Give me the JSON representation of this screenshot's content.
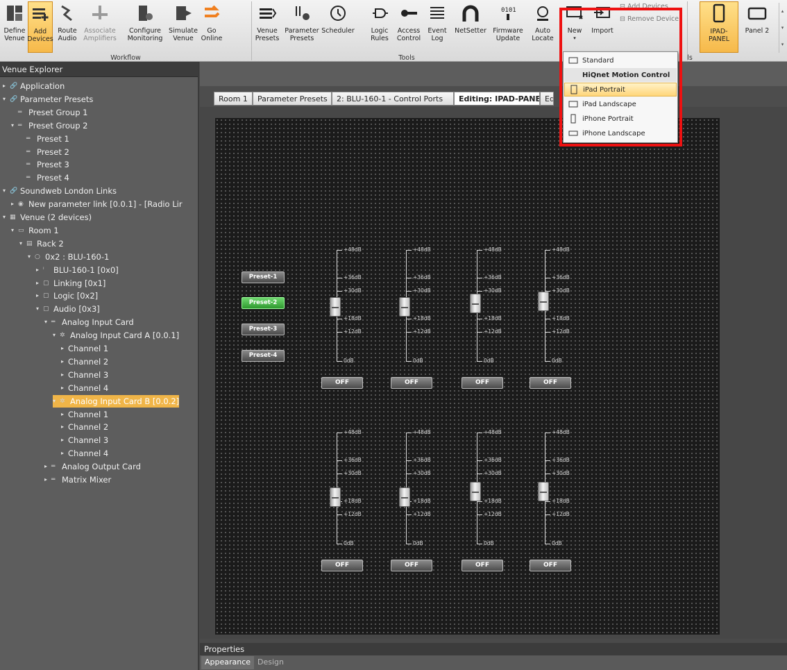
{
  "ribbon": {
    "groups": {
      "workflow": "Workflow",
      "tools": "Tools",
      "panels_partial": "ls"
    },
    "buttons": {
      "define_venue": "Define\nVenue",
      "add_devices": "Add\nDevices",
      "route_audio": "Route\nAudio",
      "associate_amplifiers": "Associate\nAmplifiers",
      "configure_monitoring": "Configure\nMonitoring",
      "simulate_venue": "Simulate\nVenue",
      "go_online": "Go\nOnline",
      "venue_presets": "Venue\nPresets",
      "parameter_presets": "Parameter\nPresets",
      "scheduler": "Scheduler",
      "logic_rules": "Logic\nRules",
      "access_control": "Access\nControl",
      "event_log": "Event\nLog",
      "netsetter": "NetSetter",
      "firmware_update": "Firmware\nUpdate",
      "auto_locate": "Auto\nLocate",
      "new": "New",
      "import": "Import",
      "add_devices_small": "Add Devices",
      "remove_device": "Remove Device",
      "ipad_panel": "IPAD-PANEL",
      "panel2": "Panel 2"
    }
  },
  "explorer": {
    "title": "Venue Explorer",
    "items": [
      {
        "label": "Application",
        "indent": 0,
        "arrow": "▸",
        "icon": "link-icon"
      },
      {
        "label": "Parameter Presets",
        "indent": 0,
        "arrow": "▾",
        "icon": "link-icon"
      },
      {
        "label": "Preset Group 1",
        "indent": 1,
        "arrow": "",
        "icon": "group-icon"
      },
      {
        "label": "Preset Group 2",
        "indent": 1,
        "arrow": "▾",
        "icon": "group-icon"
      },
      {
        "label": "Preset 1",
        "indent": 2,
        "arrow": "",
        "icon": "group-icon"
      },
      {
        "label": "Preset 2",
        "indent": 2,
        "arrow": "",
        "icon": "group-icon"
      },
      {
        "label": "Preset 3",
        "indent": 2,
        "arrow": "",
        "icon": "group-icon"
      },
      {
        "label": "Preset 4",
        "indent": 2,
        "arrow": "",
        "icon": "group-icon"
      },
      {
        "label": "Soundweb London Links",
        "indent": 0,
        "arrow": "▾",
        "icon": "link-icon"
      },
      {
        "label": "New parameter link  [0.0.1]  -  [Radio Lir",
        "indent": 1,
        "arrow": "▸",
        "icon": "param-link-icon"
      },
      {
        "label": "Venue (2 devices)",
        "indent": 0,
        "arrow": "▾",
        "icon": "venue-icon"
      },
      {
        "label": "Room 1",
        "indent": 1,
        "arrow": "▾",
        "icon": "room-icon"
      },
      {
        "label": "Rack 2",
        "indent": 2,
        "arrow": "▾",
        "icon": "rack-icon"
      },
      {
        "label": "0x2 : BLU-160-1",
        "indent": 3,
        "arrow": "▾",
        "icon": "node-icon"
      },
      {
        "label": "BLU-160-1 [0x0]",
        "indent": 4,
        "arrow": "▸",
        "icon": "info-icon"
      },
      {
        "label": "Linking [0x1]",
        "indent": 4,
        "arrow": "▸",
        "icon": "folder-icon"
      },
      {
        "label": "Logic [0x2]",
        "indent": 4,
        "arrow": "▸",
        "icon": "folder-icon"
      },
      {
        "label": "Audio [0x3]",
        "indent": 4,
        "arrow": "▾",
        "icon": "folder-icon"
      },
      {
        "label": "Analog Input Card",
        "indent": 5,
        "arrow": "▾",
        "icon": "card-icon"
      },
      {
        "label": "Analog Input Card A [0.0.1]",
        "indent": 6,
        "arrow": "▾",
        "icon": "gear-icon"
      },
      {
        "label": "Channel 1",
        "indent": 7,
        "arrow": "▸",
        "icon": ""
      },
      {
        "label": "Channel 2",
        "indent": 7,
        "arrow": "▸",
        "icon": ""
      },
      {
        "label": "Channel 3",
        "indent": 7,
        "arrow": "▸",
        "icon": ""
      },
      {
        "label": "Channel 4",
        "indent": 7,
        "arrow": "▸",
        "icon": ""
      },
      {
        "label": "Analog Input Card B [0.0.2]",
        "indent": 6,
        "arrow": "▾",
        "icon": "gear-icon",
        "selected": true
      },
      {
        "label": "Channel 1",
        "indent": 7,
        "arrow": "▸",
        "icon": ""
      },
      {
        "label": "Channel 2",
        "indent": 7,
        "arrow": "▸",
        "icon": ""
      },
      {
        "label": "Channel 3",
        "indent": 7,
        "arrow": "▸",
        "icon": ""
      },
      {
        "label": "Channel 4",
        "indent": 7,
        "arrow": "▸",
        "icon": ""
      },
      {
        "label": "Analog Output Card",
        "indent": 5,
        "arrow": "▸",
        "icon": "card-icon"
      },
      {
        "label": "Matrix Mixer",
        "indent": 5,
        "arrow": "▸",
        "icon": "card-icon"
      }
    ]
  },
  "tabs": [
    "Room 1",
    "Parameter Presets",
    "2: BLU-160-1 - Control Ports",
    "Editing: IPAD-PANEL",
    "Ed"
  ],
  "active_tab": 3,
  "panel": {
    "presets": [
      "Preset-1",
      "Preset-2",
      "Preset-3",
      "Preset-4"
    ],
    "active_preset": 1,
    "fader_scale": [
      "+48dB",
      "+36dB",
      "+30dB",
      "+18dB",
      "+12dB",
      "0dB"
    ],
    "fader_rows": [
      {
        "levels": [
          0.47,
          0.47,
          0.5,
          0.52
        ]
      },
      {
        "levels": [
          0.4,
          0.4,
          0.45,
          0.45
        ]
      }
    ],
    "off_label": "OFF"
  },
  "dropdown": {
    "items": [
      {
        "label": "Standard",
        "icon": "standard-icon"
      },
      {
        "label": "HiQnet Motion Control",
        "header": true
      },
      {
        "label": "iPad Portrait",
        "icon": "ipad-portrait-icon",
        "hover": true
      },
      {
        "label": "iPad Landscape",
        "icon": "ipad-landscape-icon"
      },
      {
        "label": "iPhone Portrait",
        "icon": "iphone-portrait-icon"
      },
      {
        "label": "iPhone Landscape",
        "icon": "iphone-landscape-icon"
      }
    ]
  },
  "properties": {
    "title": "Properties",
    "tabs": [
      "Appearance",
      "Design"
    ],
    "active": 0
  },
  "colors": {
    "accent": "#f0b548",
    "highlight": "#ee1111",
    "preset_on": "#3fb33f"
  }
}
